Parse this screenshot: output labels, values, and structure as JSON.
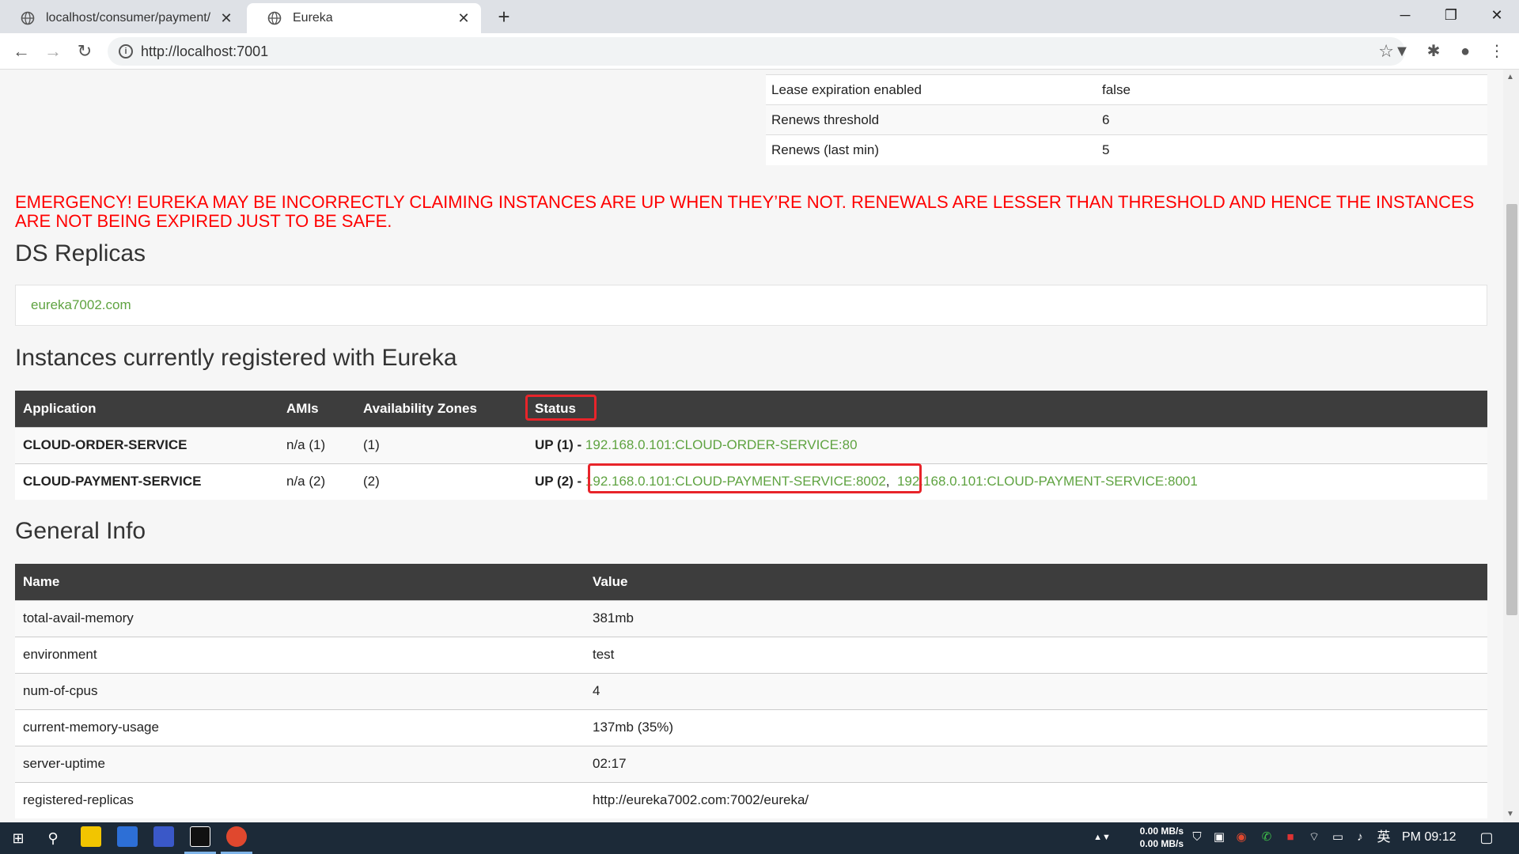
{
  "browser": {
    "tabs": [
      {
        "label": "localhost/consumer/payment/",
        "active": false
      },
      {
        "label": "Eureka",
        "active": true
      }
    ],
    "new_tab": "+",
    "url": "http://localhost:7001"
  },
  "lease": {
    "rows": [
      {
        "key": "Lease expiration enabled",
        "value": "false"
      },
      {
        "key": "Renews threshold",
        "value": "6"
      },
      {
        "key": "Renews (last min)",
        "value": "5"
      }
    ]
  },
  "emergency_message": "EMERGENCY! EUREKA MAY BE INCORRECTLY CLAIMING INSTANCES ARE UP WHEN THEY’RE NOT. RENEWALS ARE LESSER THAN THRESHOLD AND HENCE THE INSTANCES ARE NOT BEING EXPIRED JUST TO BE SAFE.",
  "ds_replicas": {
    "title": "DS Replicas",
    "link": "eureka7002.com"
  },
  "instances": {
    "title": "Instances currently registered with Eureka",
    "headers": [
      "Application",
      "AMIs",
      "Availability Zones",
      "Status"
    ],
    "rows": [
      {
        "application": "CLOUD-ORDER-SERVICE",
        "amis": "n/a (1)",
        "zones": "(1)",
        "status_prefix": "UP (1) - ",
        "links": [
          "192.168.0.101:CLOUD-ORDER-SERVICE:80"
        ]
      },
      {
        "application": "CLOUD-PAYMENT-SERVICE",
        "amis": "n/a (2)",
        "zones": "(2)",
        "status_prefix": "UP (2) - ",
        "links": [
          "192.168.0.101:CLOUD-PAYMENT-SERVICE:8002",
          "192.168.0.101:CLOUD-PAYMENT-SERVICE:8001"
        ],
        "separator": ",  "
      }
    ]
  },
  "general_info": {
    "title": "General Info",
    "headers": [
      "Name",
      "Value"
    ],
    "rows": [
      {
        "name": "total-avail-memory",
        "value": "381mb"
      },
      {
        "name": "environment",
        "value": "test"
      },
      {
        "name": "num-of-cpus",
        "value": "4"
      },
      {
        "name": "current-memory-usage",
        "value": "137mb (35%)"
      },
      {
        "name": "server-uptime",
        "value": "02:17"
      },
      {
        "name": "registered-replicas",
        "value": "http://eureka7002.com:7002/eureka/"
      }
    ]
  },
  "taskbar": {
    "net_up": "0.00 MB/s",
    "net_down": "0.00 MB/s",
    "ime": "英",
    "clock": "PM 09:12"
  },
  "colors": {
    "link": "#5fa341",
    "emergency": "#ff0000",
    "table_header": "#3d3d3d",
    "highlight": "#e8242a"
  }
}
